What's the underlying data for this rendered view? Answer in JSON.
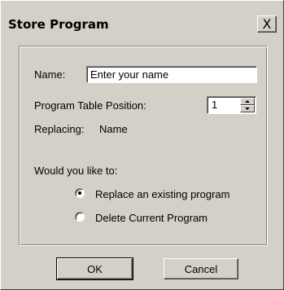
{
  "dialog": {
    "title": "Store Program",
    "close_glyph": "X"
  },
  "form": {
    "name_label": "Name:",
    "name_value": "Enter your name",
    "position_label": "Program Table Position:",
    "position_value": "1",
    "replacing_label": "Replacing:",
    "replacing_value": "Name",
    "question": "Would you like to:",
    "options": [
      {
        "label": "Replace an existing program",
        "selected": true
      },
      {
        "label": "Delete Current Program",
        "selected": false
      }
    ]
  },
  "buttons": {
    "ok": "OK",
    "cancel": "Cancel"
  },
  "icons": {
    "close": "close-icon",
    "spin_up": "arrow-up-icon",
    "spin_down": "arrow-down-icon"
  }
}
